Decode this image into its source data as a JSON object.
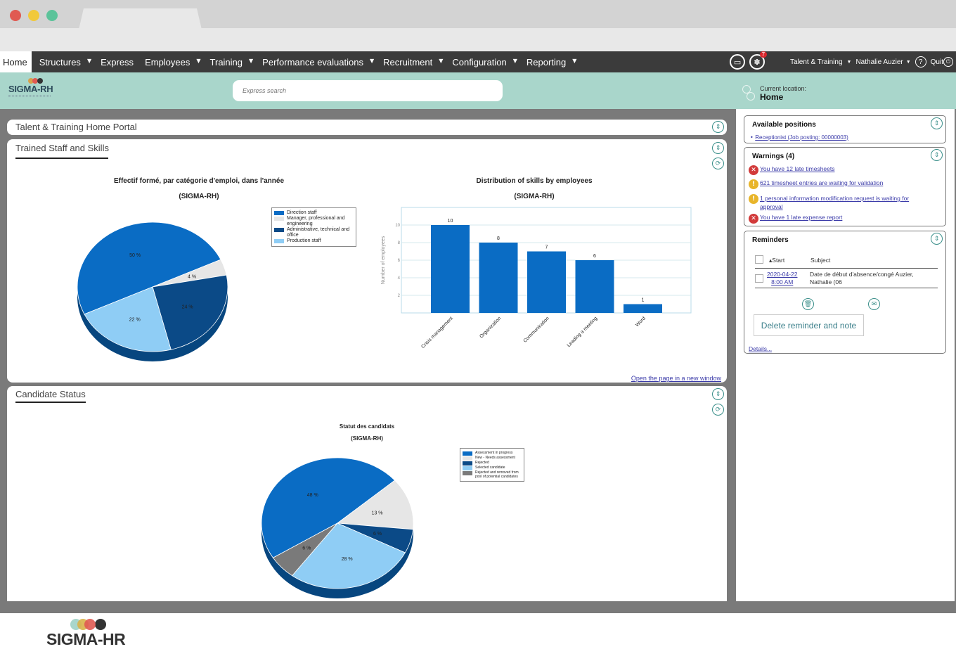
{
  "window": {
    "controls": [
      "close",
      "minimize",
      "maximize"
    ]
  },
  "navbar": {
    "items": [
      {
        "label": "Home",
        "active": true,
        "dropdown": false
      },
      {
        "label": "Structures",
        "dropdown": true
      },
      {
        "label": "Express",
        "dropdown": false
      },
      {
        "label": "Employees",
        "dropdown": true
      },
      {
        "label": "Training",
        "dropdown": true
      },
      {
        "label": "Performance evaluations",
        "dropdown": true
      },
      {
        "label": "Recruitment",
        "dropdown": true
      },
      {
        "label": "Configuration",
        "dropdown": true
      },
      {
        "label": "Reporting",
        "dropdown": true
      }
    ],
    "notification_count": "7",
    "module": "Talent & Training",
    "user": "Nathalie Auzier",
    "help": "?",
    "quit": "Quit"
  },
  "header": {
    "logo": "SIGMA-RH",
    "search_placeholder": "Express search",
    "location_label": "Current location:",
    "location_value": "Home"
  },
  "portal": {
    "title": "Talent & Training Home Portal"
  },
  "trained_panel": {
    "title": "Trained Staff and Skills",
    "open_link": "Open the page in a new window"
  },
  "candidate_panel": {
    "title": "Candidate Status"
  },
  "chart_data": [
    {
      "type": "pie",
      "title": "Effectif formé, par catégorie d'emploi, dans l'année",
      "subtitle": "(SIGMA-RH)",
      "legend_position": "right",
      "slices": [
        {
          "label": "Direction staff",
          "value": 50,
          "display": "50 %",
          "color": "#0a6cc4"
        },
        {
          "label": "Manager, professional and engineering",
          "value": 4,
          "display": "4 %",
          "color": "#e6e6e6"
        },
        {
          "label": "Administrative, technical and office",
          "value": 24,
          "display": "24 %",
          "color": "#0b4a87"
        },
        {
          "label": "Production staff",
          "value": 22,
          "display": "22 %",
          "color": "#8fcdf5"
        }
      ]
    },
    {
      "type": "bar",
      "title": "Distribution of skills by employees",
      "subtitle": "(SIGMA-RH)",
      "xlabel": "",
      "ylabel": "Number of employees",
      "ylim": [
        0,
        12
      ],
      "yticks": [
        2,
        4,
        6,
        8,
        10
      ],
      "grid": true,
      "categories": [
        "Crisis management",
        "Organization",
        "Communication",
        "Leading a meeting",
        "Word"
      ],
      "values": [
        10,
        8,
        7,
        6,
        1
      ],
      "color": "#0a6cc4"
    },
    {
      "type": "pie",
      "title": "Statut des candidats",
      "subtitle": "(SIGMA-RH)",
      "legend_position": "right",
      "slices": [
        {
          "label": "Assessment in progress",
          "value": 48,
          "display": "48 %",
          "color": "#0a6cc4"
        },
        {
          "label": "New - Needs assessment",
          "value": 13,
          "display": "13 %",
          "color": "#e6e6e6"
        },
        {
          "label": "Rejected",
          "value": 6,
          "display": "6 %",
          "color": "#0b4a87"
        },
        {
          "label": "Selected candidate",
          "value": 28,
          "display": "28 %",
          "color": "#8fcdf5"
        },
        {
          "label": "Rejected and removed from pool of potential candidates",
          "value": 6,
          "display": "6 %",
          "color": "#7a7a7a"
        }
      ]
    }
  ],
  "sidebar": {
    "positions": {
      "title": "Available positions",
      "items": [
        "Receptionist (Job posting: 00000003)"
      ]
    },
    "warnings": {
      "title": "Warnings (4)",
      "items": [
        {
          "type": "error",
          "text": "You have 12 late timesheets"
        },
        {
          "type": "warning",
          "text": "621 timesheet entries are waiting for validation"
        },
        {
          "type": "warning",
          "text": "1 personal information modification request is waiting for approval"
        },
        {
          "type": "error",
          "text": "You have 1 late expense report"
        }
      ]
    },
    "reminders": {
      "title": "Reminders",
      "col_start": "Start",
      "col_subject": "Subject",
      "rows": [
        {
          "date": "2020-04-22",
          "time": "8:00 AM",
          "subject": "Date de début d'absence/congé Auzier, Nathalie (06"
        }
      ],
      "delete_button": "Delete reminder and note",
      "details_link": "Details..."
    }
  },
  "footer": {
    "logo": "SIGMA-HR"
  }
}
